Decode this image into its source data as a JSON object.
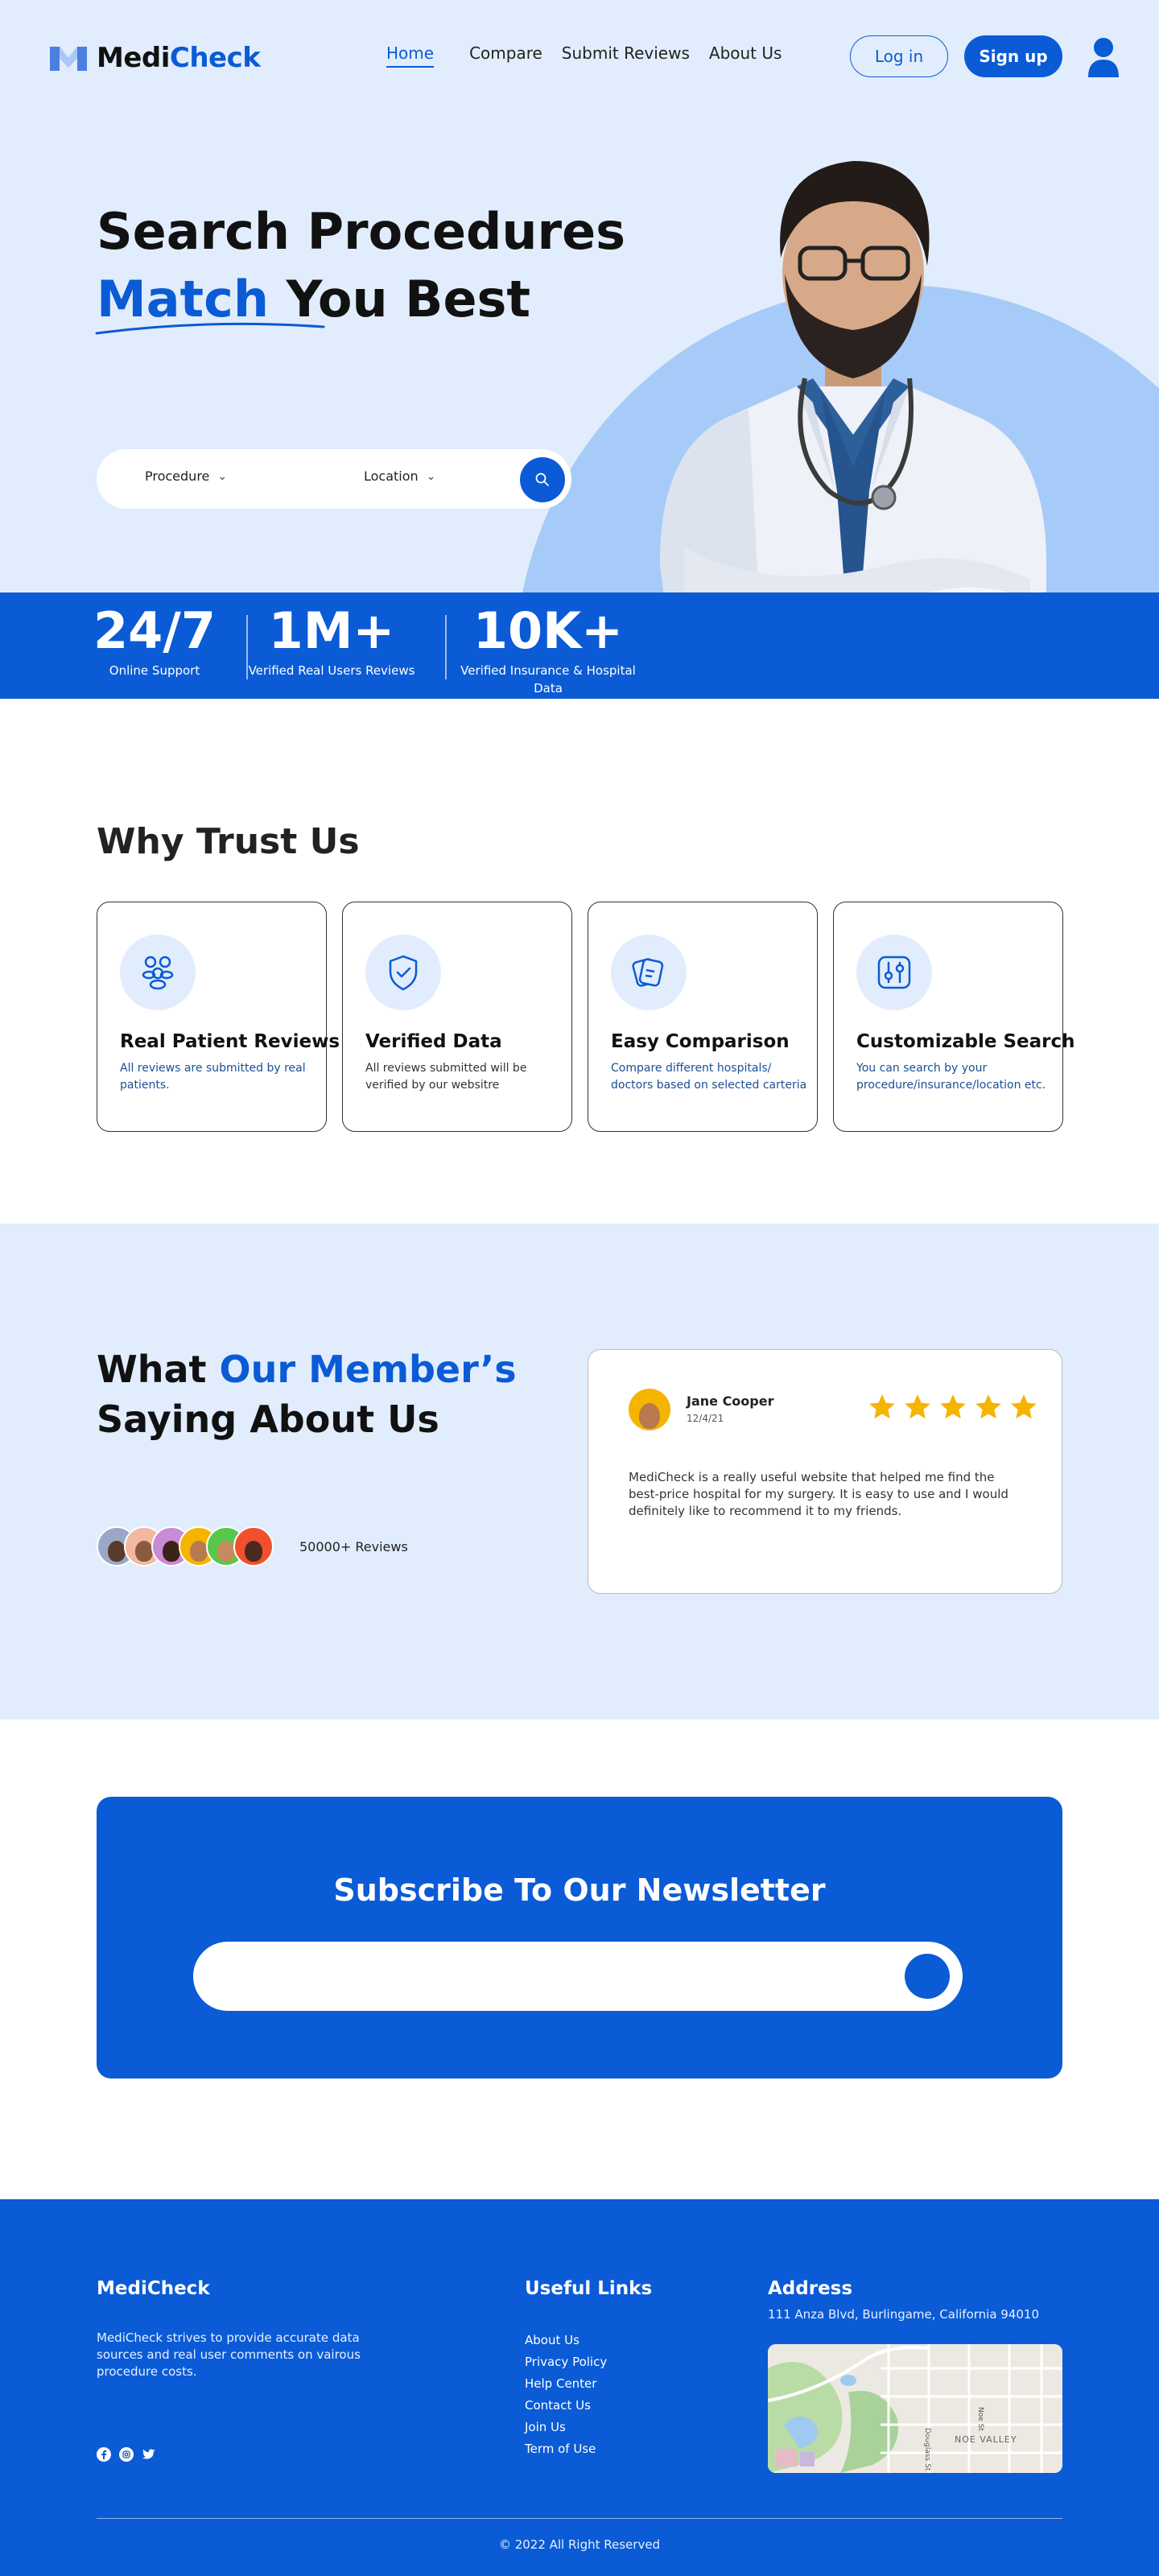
{
  "brand": {
    "name_part1": "Medi",
    "name_part2": "Check",
    "accent_color": "#0a5bd5",
    "hero_bg": "#e1edfc"
  },
  "nav": {
    "items": [
      "Home",
      "Compare",
      "Submit Reviews",
      "About Us"
    ],
    "active": "Home"
  },
  "header": {
    "login_label": "Log in",
    "signup_label": "Sign up",
    "user_icon": "user-icon"
  },
  "hero": {
    "title_line1": "Search Procedures",
    "title_accent": "Match",
    "title_rest": " You Best",
    "search": {
      "procedure_label": "Procedure",
      "location_label": "Location",
      "search_icon": "search-icon"
    }
  },
  "stats": [
    {
      "value": "24/7",
      "label": "Online Support"
    },
    {
      "value": "1M+",
      "label": "Verified Real Users Reviews"
    },
    {
      "value": "10K+",
      "label": "Verified Insurance & Hospital Data"
    }
  ],
  "why": {
    "title": "Why Trust Us",
    "cards": [
      {
        "title": "Real Patient Reviews",
        "desc": "All reviews are submitted by real patients.",
        "icon": "people-icon"
      },
      {
        "title": "Verified Data",
        "desc": "All reviews submitted will be verified by our websitre",
        "icon": "shield-check-icon"
      },
      {
        "title": "Easy Comparison",
        "desc": "Compare different hospitals/ doctors based on selected carteria",
        "icon": "compare-cards-icon"
      },
      {
        "title": "Customizable Search",
        "desc": "You can search by your procedure/insurance/location etc.",
        "icon": "sliders-icon"
      }
    ]
  },
  "testimonials": {
    "title_part1": "What ",
    "title_accent": "Our Member’s",
    "title_line2": "Saying About Us",
    "reviews_count": "50000+ Reviews",
    "review": {
      "name": "Jane Cooper",
      "date": "12/4/21",
      "rating": 5,
      "text": "MediCheck is a really useful website that helped me find the best-price hospital for my surgery. It is easy to use and I would definitely like to recommend it to my friends."
    }
  },
  "newsletter": {
    "title": "Subscribe To Our Newsletter",
    "placeholder": ""
  },
  "footer": {
    "brand": "MediCheck",
    "about": "MediCheck strives to provide accurate data sources and real user comments on vairous procedure costs.",
    "links_title": "Useful Links",
    "links": [
      "About Us",
      "Privacy Policy",
      "Help Center",
      "Contact Us",
      "Join Us",
      "Term of Use"
    ],
    "address_title": "Address",
    "address": "111 Anza Blvd, Burlingame, California 94010",
    "map_labels": [
      "Noe St",
      "Douglass St",
      "NOE VALLEY"
    ],
    "copyright": "2022 All Right Reserved",
    "social_icons": [
      "facebook-icon",
      "instagram-icon",
      "twitter-icon"
    ]
  }
}
